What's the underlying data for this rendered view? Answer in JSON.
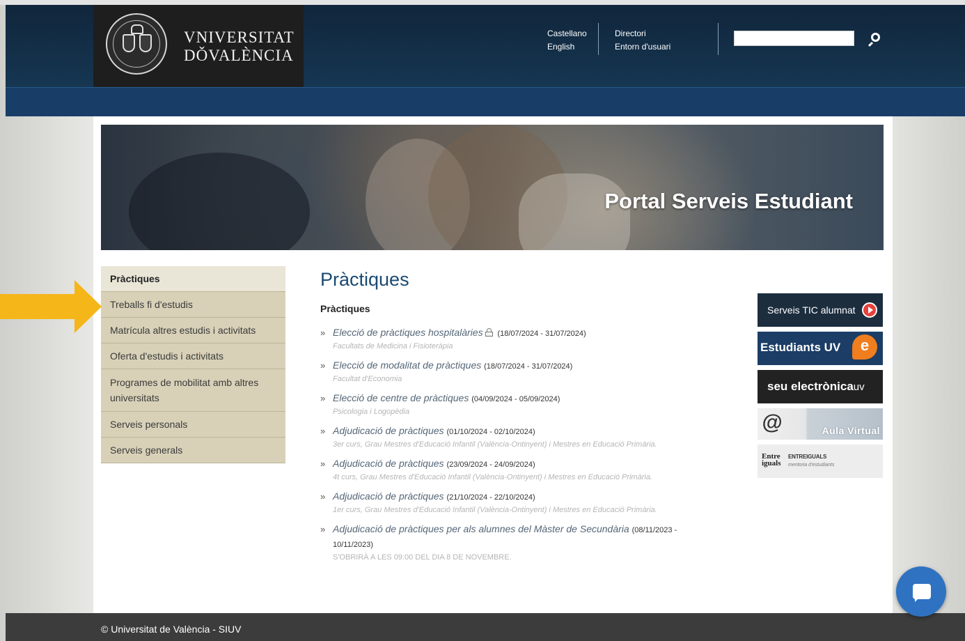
{
  "header": {
    "university_name_line1": "VNIVERSITAT",
    "university_name_line2": "DǑVALÈNCIA",
    "lang_links": [
      "Castellano",
      "English"
    ],
    "user_links": [
      "Directori",
      "Entorn d'usuari"
    ],
    "search": {
      "value": "",
      "icon": "search-icon"
    }
  },
  "banner": {
    "title": "Portal Serveis Estudiant"
  },
  "sidebar": {
    "items": [
      {
        "label": "Pràctiques",
        "active": true
      },
      {
        "label": "Treballs fi d'estudis"
      },
      {
        "label": "Matrícula altres estudis i activitats"
      },
      {
        "label": "Oferta d'estudis i activitats"
      },
      {
        "label": "Programes de mobilitat amb altres universitats"
      },
      {
        "label": "Serveis personals"
      },
      {
        "label": "Serveis generals"
      }
    ]
  },
  "annotation": {
    "arrow_color": "#f5b619",
    "icon": "arrow-right-icon"
  },
  "main": {
    "title": "Pràctiques",
    "section_title": "Pràctiques",
    "entries": [
      {
        "title": "Elecció de pràctiques hospitalàries",
        "locked": true,
        "dates": "(18/07/2024 - 31/07/2024)",
        "subtitle": "Facultats de Medicina i Fisioteràpia"
      },
      {
        "title": "Elecció de modalitat de pràctiques",
        "dates": "(18/07/2024 - 31/07/2024)",
        "subtitle": "Facultat d'Economia"
      },
      {
        "title": "Elecció de centre de pràctiques",
        "dates": "(04/09/2024 - 05/09/2024)",
        "subtitle": "Psicologia i Logopèdia"
      },
      {
        "title": "Adjudicació de pràctiques",
        "dates": "(01/10/2024 - 02/10/2024)",
        "subtitle": "3er curs, Grau Mestres d'Educació Infantil (València-Ontinyent) i Mestres en Educació Primària."
      },
      {
        "title": "Adjudicació de pràctiques",
        "dates": "(23/09/2024 - 24/09/2024)",
        "subtitle": "4t curs, Grau Mestres d'Educació Infantil (València-Ontinyent) i Mestres en Educació Primària."
      },
      {
        "title": "Adjudicació de pràctiques",
        "dates": "(21/10/2024 - 22/10/2024)",
        "subtitle": "1er curs, Grau Mestres d'Educació Infantil (València-Ontinyent) i Mestres en Educació Primària."
      },
      {
        "title": "Adjudicació de pràctiques per als alumnes del Màster de Secundària",
        "dates": "(08/11/2023 - 10/11/2023)",
        "subtitle": "S'OBRIRÀ A LES 09:00 DEL DIA 8 DE NOVEMBRE."
      }
    ]
  },
  "right_links": {
    "tic": "Serveis TIC alumnat",
    "estudiants": "Estudiants UV",
    "estudiants_badge": "e",
    "seu": "seu electrònica",
    "seu_suffix": "uv",
    "aula": "Aula Virtual",
    "aula_symbol": "@",
    "entre_logo_line1": "Entre",
    "entre_logo_line2": "iguals",
    "entre_title": "ENTREIGUALS",
    "entre_sub": "mentoria d'estudiants"
  },
  "footer": {
    "text": "© Universitat de València - SIUV"
  },
  "chat": {
    "icon": "chat-icon"
  }
}
